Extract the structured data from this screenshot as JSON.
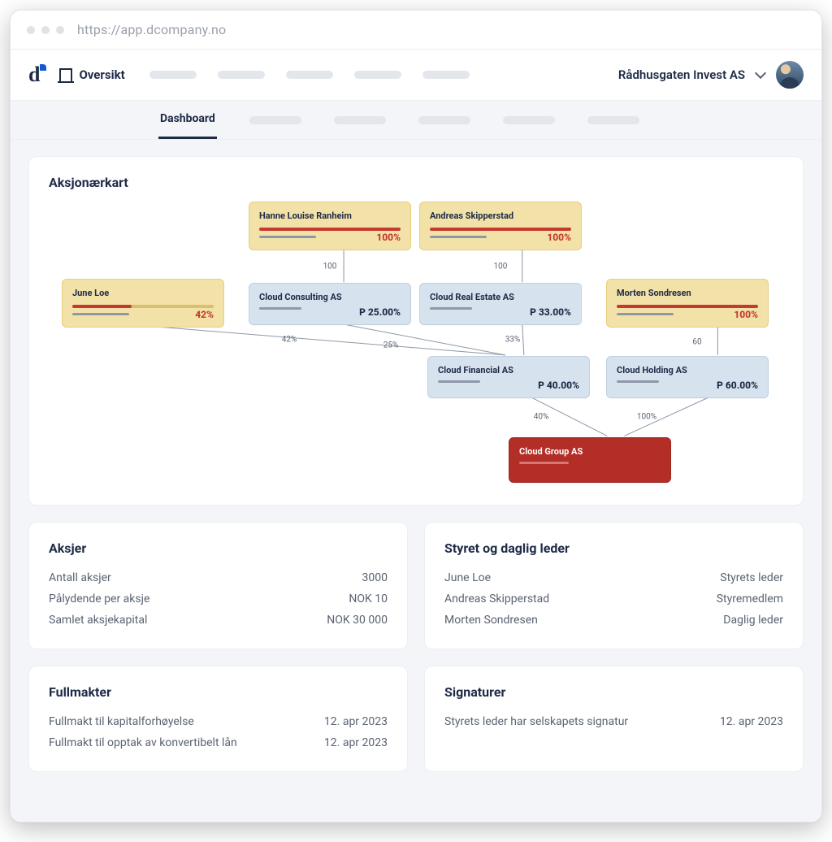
{
  "browser": {
    "url": "https://app.dcompany.no"
  },
  "header": {
    "nav_oversikt": "Oversikt",
    "org_name": "Rådhusgaten Invest AS"
  },
  "tabs": {
    "dashboard": "Dashboard"
  },
  "map": {
    "title": "Aksjonærkart",
    "nodes": {
      "june": {
        "label": "June Loe",
        "pct": "42%"
      },
      "hanne": {
        "label": "Hanne Louise Ranheim",
        "pct": "100%"
      },
      "andreas": {
        "label": "Andreas Skipperstad",
        "pct": "100%"
      },
      "morten": {
        "label": "Morten Sondresen",
        "pct": "100%"
      },
      "consult": {
        "label": "Cloud Consulting AS",
        "pct": "P 25.00%"
      },
      "estate": {
        "label": "Cloud Real Estate AS",
        "pct": "P 33.00%"
      },
      "fin": {
        "label": "Cloud Financial AS",
        "pct": "P 40.00%"
      },
      "hold": {
        "label": "Cloud Holding AS",
        "pct": "P 60.00%"
      },
      "group": {
        "label": "Cloud Group AS"
      }
    },
    "edges": {
      "hanne_consult": "100",
      "andreas_estate": "100",
      "june_fin": "42%",
      "consult_fin": "25%",
      "estate_fin": "33%",
      "morten_hold": "60",
      "fin_group": "40%",
      "hold_group": "100%"
    }
  },
  "shares": {
    "title": "Aksjer",
    "rows": [
      {
        "k": "Antall aksjer",
        "v": "3000"
      },
      {
        "k": "Pålydende per aksje",
        "v": "NOK 10"
      },
      {
        "k": "Samlet aksjekapital",
        "v": "NOK 30 000"
      }
    ]
  },
  "board": {
    "title": "Styret og daglig leder",
    "rows": [
      {
        "k": "June Loe",
        "v": "Styrets leder"
      },
      {
        "k": "Andreas Skipperstad",
        "v": "Styremedlem"
      },
      {
        "k": "Morten Sondresen",
        "v": "Daglig leder"
      }
    ]
  },
  "poa": {
    "title": "Fullmakter",
    "rows": [
      {
        "k": "Fullmakt til kapitalforhøyelse",
        "v": "12. apr 2023"
      },
      {
        "k": "Fullmakt til opptak av konvertibelt lån",
        "v": "12. apr 2023"
      }
    ]
  },
  "sign": {
    "title": "Signaturer",
    "rows": [
      {
        "k": "Styrets leder har selskapets signatur",
        "v": "12. apr 2023"
      }
    ]
  }
}
